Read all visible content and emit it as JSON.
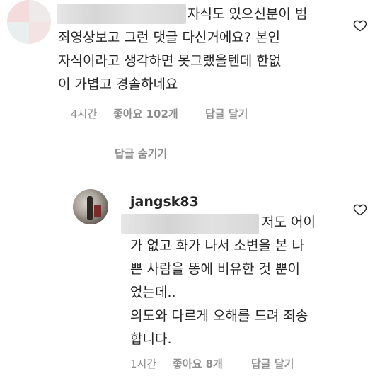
{
  "comment": {
    "lines": [
      "자식도 있으신분이 범",
      "죄영상보고 그런 댓글 다신거에요? 본인",
      "자식이라고 생각하면 못그랬을텐데 한없",
      "이 가볍고 경솔하네요"
    ],
    "time": "4시간",
    "likes": "좋아요 102개",
    "reply": "답글 달기"
  },
  "hide_replies": "답글 숨기기",
  "reply_comment": {
    "username": "jangsk83",
    "lines": [
      "저도 어이",
      "가 없고 화가 나서 소변을 본 나",
      "쁜 사람을 똥에 비유한 것 뿐이",
      "었는데..",
      "의도와 다르게 오해를 드려 죄송",
      "합니다."
    ],
    "time": "1시간",
    "likes": "좋아요 8개",
    "reply": "답글 달기"
  },
  "icons": {
    "like": "heart-outline-icon"
  },
  "colors": {
    "text": "#262626",
    "secondary": "#8e8e8e"
  }
}
